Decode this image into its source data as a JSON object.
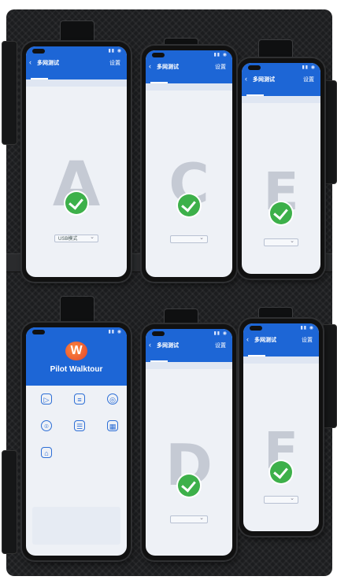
{
  "phones": [
    {
      "id": "A",
      "app_title": "多网测试",
      "settings_label": "设置",
      "letter": "A"
    },
    {
      "id": "C",
      "app_title": "多网测试",
      "settings_label": "设置",
      "letter": "C"
    },
    {
      "id": "E",
      "app_title": "多网测试",
      "settings_label": "设置",
      "letter": "E"
    },
    {
      "id": "W",
      "app_name": "Pilot Walktour"
    },
    {
      "id": "D",
      "app_title": "多网测试",
      "settings_label": "设置",
      "letter": "D"
    },
    {
      "id": "F",
      "app_title": "多网测试",
      "settings_label": "设置",
      "letter": "F"
    }
  ],
  "phone_a": {
    "mode_label": "USB模式"
  },
  "colors": {
    "app_blue": "#1d66d6",
    "check_green": "#3db04a",
    "rack": "#1c1d1f"
  },
  "icons": [
    "back-arrow-icon",
    "checkmark-icon",
    "walktour-logo-icon",
    "dropdown-chevron-icon"
  ]
}
